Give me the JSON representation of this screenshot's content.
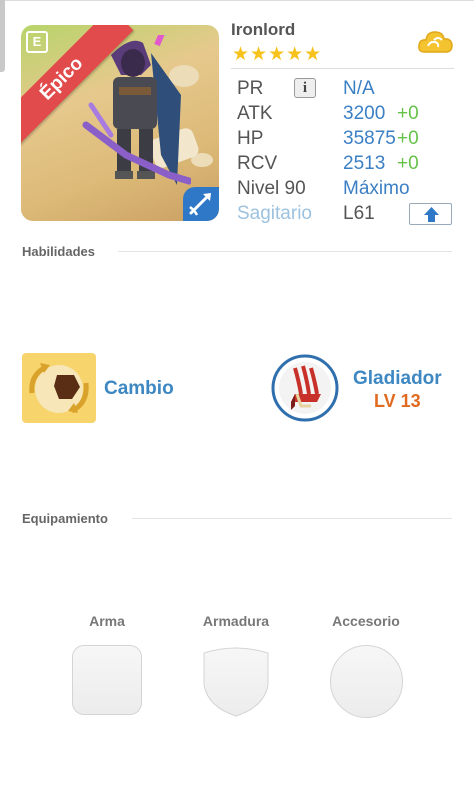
{
  "hero": {
    "name": "Ironlord",
    "stars": "★★★★★",
    "rarity": "Épico",
    "notes_glyph": "E"
  },
  "stats": [
    {
      "label": "PR",
      "value": "N/A",
      "bonus": ""
    },
    {
      "label": "ATK",
      "value": "3200",
      "bonus": "+0"
    },
    {
      "label": "HP",
      "value": "35875",
      "bonus": "+0"
    },
    {
      "label": "RCV",
      "value": "2513",
      "bonus": "+0"
    },
    {
      "label": "Nivel 90",
      "value": "Máximo",
      "bonus": ""
    },
    {
      "label": "Sagitario",
      "value": "L61",
      "bonus": ""
    }
  ],
  "info_glyph": "i",
  "sections": {
    "skills_title": "Habilidades",
    "equipment_title": "Equipamiento"
  },
  "skill": {
    "name": "Cambio"
  },
  "leader_skill": {
    "name": "Gladiador",
    "level": "LV 13"
  },
  "equipment": {
    "slots": [
      {
        "label": "Arma"
      },
      {
        "label": "Armadura"
      },
      {
        "label": "Accesorio"
      }
    ]
  },
  "colors": {
    "rarity_ribbon": "#e24b4b",
    "stat_value": "#3b7fc4",
    "stat_bonus": "#67c24a",
    "constellation": "#9cc2e0",
    "skill_name": "#3d87c2",
    "leader_level": "#e06a1f",
    "stars": "#f6c21b"
  },
  "icons": {
    "notes": "notes-icon",
    "class": "archer-class-icon",
    "cloud": "cloud-icon",
    "info": "info-icon",
    "upgrade": "arrow-up-icon",
    "skill": "swap-skill-icon",
    "leader": "gladiator-claw-icon"
  }
}
